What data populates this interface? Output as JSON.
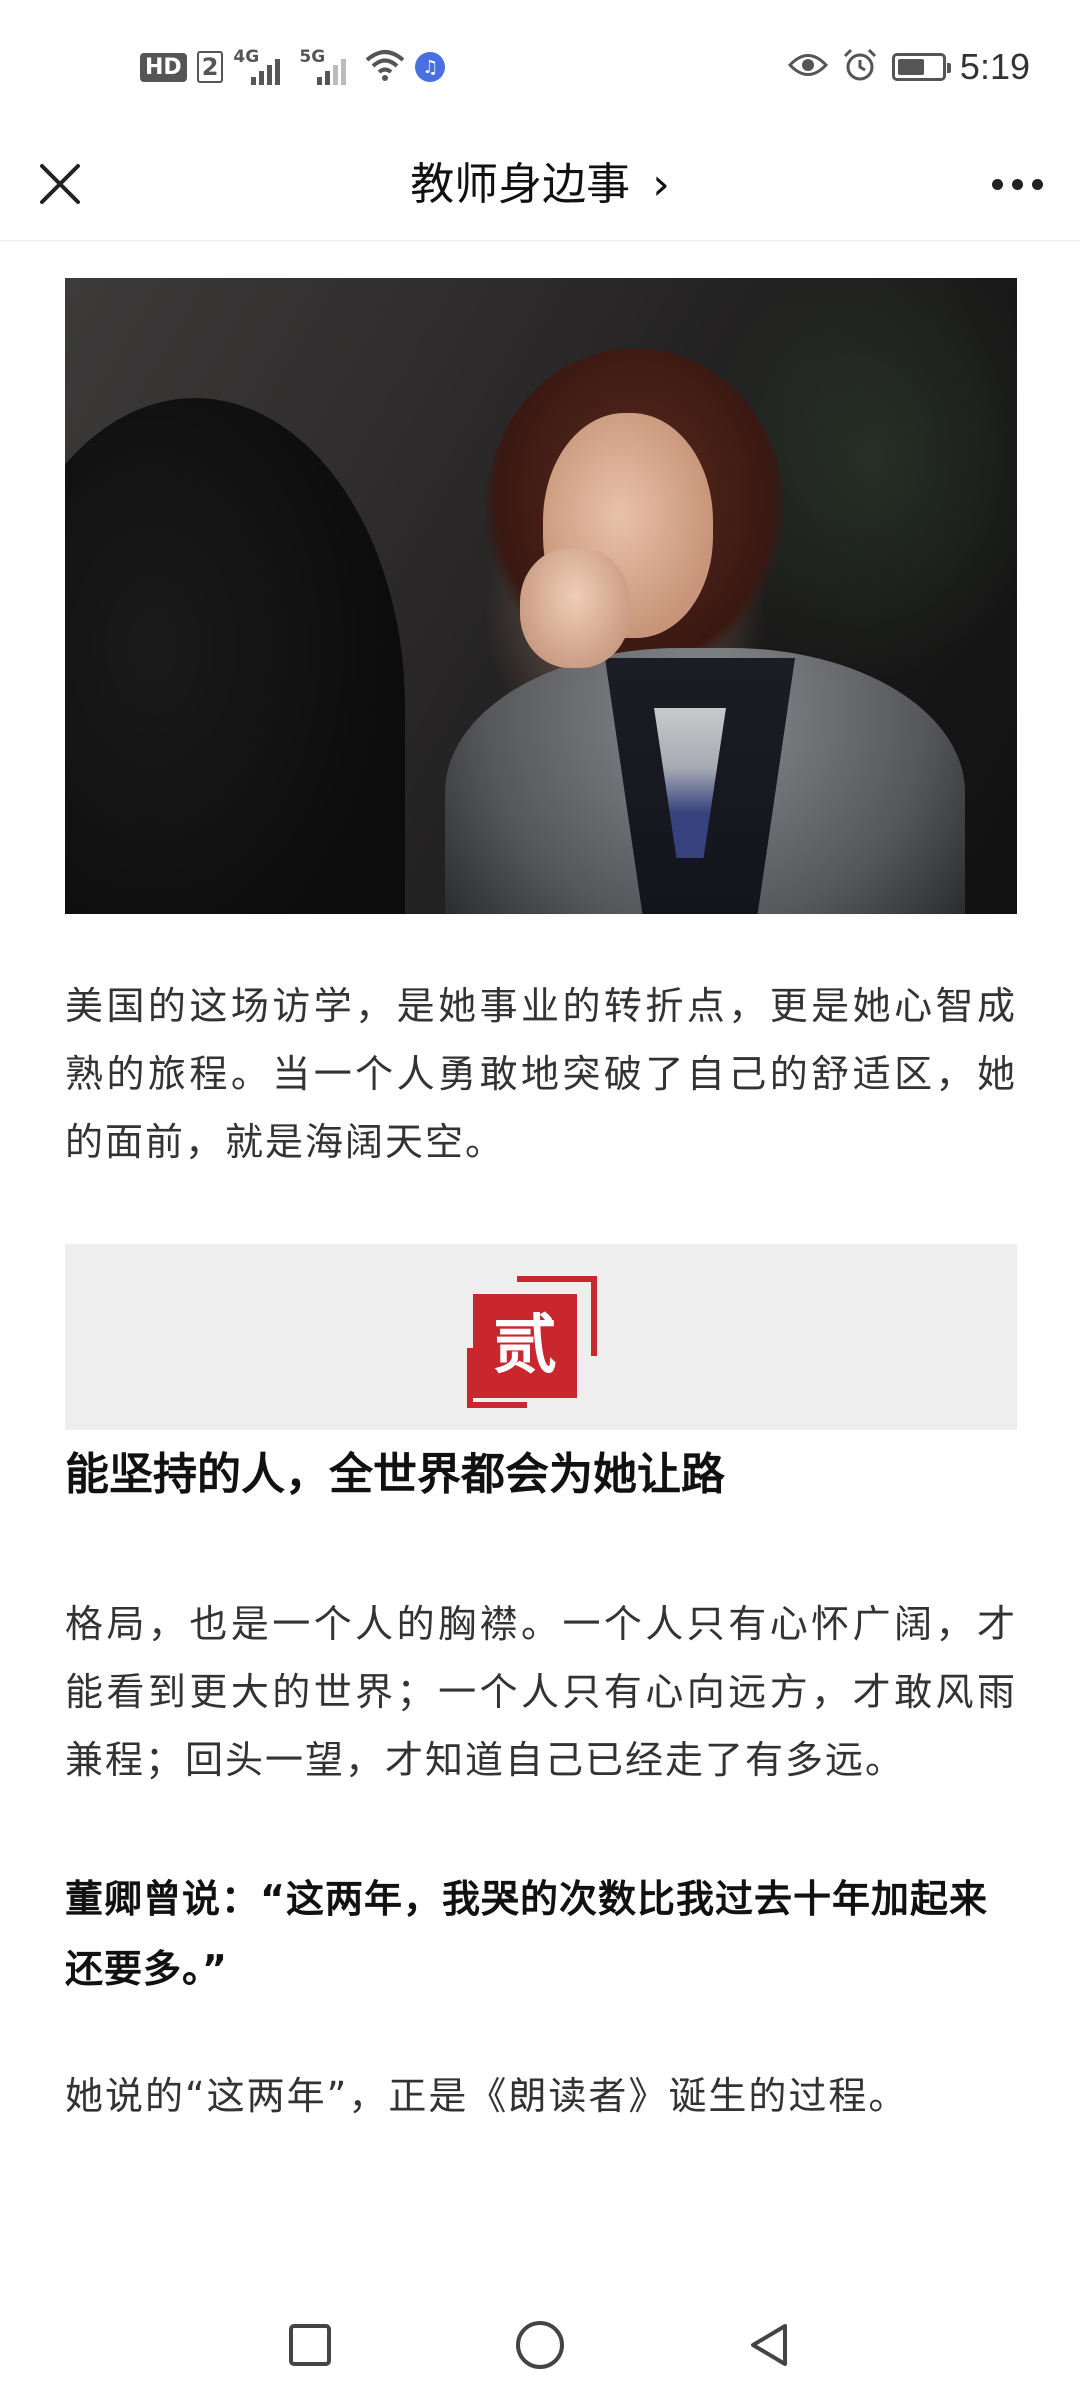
{
  "status_bar": {
    "hd_label": "HD",
    "sim_number": "2",
    "net1_label": "4G",
    "net2_label": "5G",
    "time": "5:19",
    "icons": [
      "wifi-icon",
      "music-icon",
      "eye-icon",
      "alarm-icon",
      "battery-icon"
    ]
  },
  "header": {
    "title": "教师身边事",
    "chevron": "›",
    "icons": [
      "close-icon",
      "more-icon"
    ]
  },
  "article": {
    "para1": "美国的这场访学，是她事业的转折点，更是她心智成熟的旅程。当一个人勇敢地突破了自己的舒适区，她的面前，就是海阔天空。",
    "seal_text": "贰",
    "section_title": "能坚持的人，全世界都会为她让路",
    "para2": "格局，也是一个人的胸襟。一个人只有心怀广阔，才能看到更大的世界；一个人只有心向远方，才敢风雨兼程；回头一望，才知道自己已经走了有多远。",
    "quote": "董卿曾说：“这两年，我哭的次数比我过去十年加起来还要多。”",
    "para3": "她说的“这两年”，正是《朗读者》诞生的过程。"
  },
  "nav_bar": {
    "icons": [
      "recent-apps-icon",
      "home-icon",
      "back-icon"
    ]
  },
  "colors": {
    "seal_red": "#c8272d",
    "banner_bg": "#efeeee",
    "body_text": "#333333"
  }
}
